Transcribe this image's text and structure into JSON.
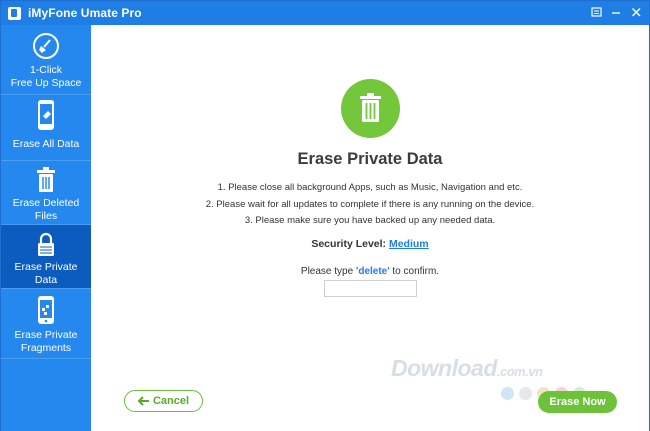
{
  "window": {
    "title": "iMyFone Umate Pro"
  },
  "sidebar": {
    "items": [
      {
        "label_line1": "1-Click",
        "label_line2": "Free Up Space"
      },
      {
        "label_line1": "Erase All Data",
        "label_line2": ""
      },
      {
        "label_line1": "Erase Deleted",
        "label_line2": "Files"
      },
      {
        "label_line1": "Erase Private",
        "label_line2": "Data"
      },
      {
        "label_line1": "Erase Private",
        "label_line2": "Fragments"
      }
    ],
    "active_index": 3
  },
  "main": {
    "title": "Erase Private Data",
    "instructions": [
      "1. Please close all background Apps, such as Music, Navigation and etc.",
      "2. Please wait for all updates to complete if there is any running on the device.",
      "3. Please make sure you have backed up any needed data."
    ],
    "security_label": "Security Level:",
    "security_value": "Medium",
    "confirm_prefix": "Please type",
    "confirm_keyword": "'delete'",
    "confirm_suffix": "to confirm.",
    "confirm_input_value": "",
    "cancel_label": "Cancel",
    "erase_label": "Erase Now"
  },
  "watermark": {
    "text": "Download",
    "suffix": ".com.vn"
  },
  "colors": {
    "accent": "#1f7de6",
    "sidebar": "#2588ee",
    "sidebar_active": "#0c5cbf",
    "green": "#6cc33a"
  }
}
